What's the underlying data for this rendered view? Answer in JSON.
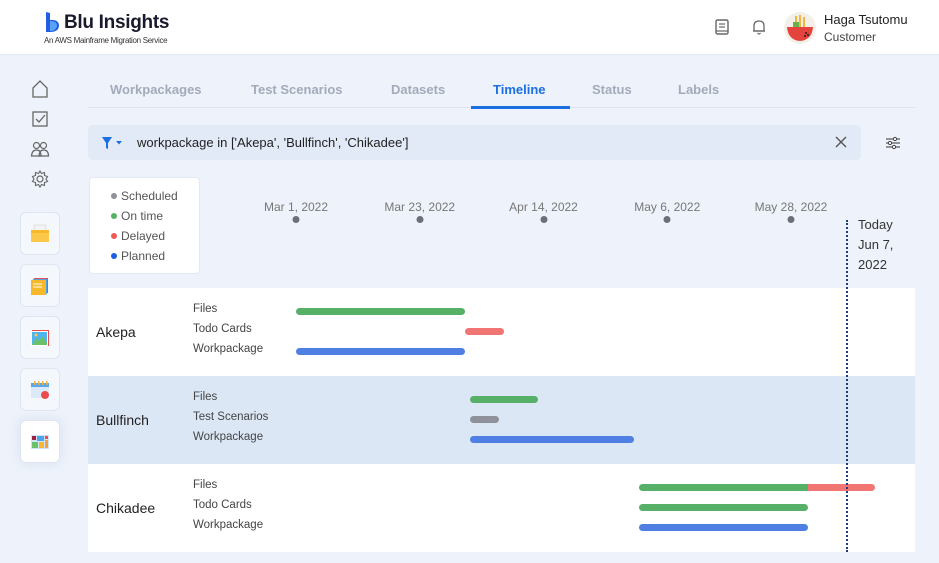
{
  "header": {
    "app_title": "Blu Insights",
    "app_subtitle": "An AWS Mainframe Migration Service",
    "user": {
      "name": "Haga Tsutomu",
      "role": "Customer"
    },
    "icons": [
      "documentation-icon",
      "bell-icon"
    ]
  },
  "sidebar": {
    "nav_icons": [
      "home-icon",
      "checkbox-icon",
      "users-icon",
      "gear-icon"
    ],
    "apps": [
      {
        "name": "folder-app"
      },
      {
        "name": "notes-app"
      },
      {
        "name": "image-app"
      },
      {
        "name": "calendar-app"
      },
      {
        "name": "dashboard-app",
        "active": true
      }
    ]
  },
  "tabs": [
    {
      "label": "Workpackages"
    },
    {
      "label": "Test Scenarios"
    },
    {
      "label": "Datasets"
    },
    {
      "label": "Timeline",
      "active": true
    },
    {
      "label": "Status"
    },
    {
      "label": "Labels"
    }
  ],
  "filter": {
    "query": "workpackage in ['Akepa', 'Bullfinch', 'Chikadee']"
  },
  "colors": {
    "scheduled": "#8e9199",
    "on_time": "#57b067",
    "delayed": "#f07573",
    "planned": "#4f7fe3",
    "accent": "#1b6fe0"
  },
  "legend": [
    {
      "label": "Scheduled",
      "key": "scheduled"
    },
    {
      "label": "On time",
      "key": "on_time"
    },
    {
      "label": "Delayed",
      "key": "delayed"
    },
    {
      "label": "Planned",
      "key": "planned"
    }
  ],
  "chart_data": {
    "type": "gantt",
    "start_date": "Mar 1, 2022",
    "x_ticks": [
      {
        "label": "Mar 1, 2022",
        "day": 0
      },
      {
        "label": "Mar 23, 2022",
        "day": 22
      },
      {
        "label": "Apr 14, 2022",
        "day": 44
      },
      {
        "label": "May 6, 2022",
        "day": 66
      },
      {
        "label": "May 28, 2022",
        "day": 88
      }
    ],
    "today": {
      "label_1": "Today",
      "label_2": "Jun 7,",
      "label_3": "2022",
      "day": 98
    },
    "x_range_days": [
      0,
      103
    ],
    "groups": [
      {
        "name": "Akepa",
        "rows": [
          {
            "label": "Files",
            "segments": [
              {
                "start": 0,
                "end": 30,
                "status": "on_time"
              }
            ]
          },
          {
            "label": "Todo Cards",
            "segments": [
              {
                "start": 30,
                "end": 37,
                "status": "delayed"
              }
            ]
          },
          {
            "label": "Workpackage",
            "segments": [
              {
                "start": 0,
                "end": 30,
                "status": "planned"
              }
            ]
          }
        ]
      },
      {
        "name": "Bullfinch",
        "highlighted": true,
        "rows": [
          {
            "label": "Files",
            "segments": [
              {
                "start": 31,
                "end": 43,
                "status": "on_time"
              }
            ]
          },
          {
            "label": "Test Scenarios",
            "segments": [
              {
                "start": 31,
                "end": 36,
                "status": "scheduled"
              }
            ]
          },
          {
            "label": "Workpackage",
            "segments": [
              {
                "start": 31,
                "end": 60,
                "status": "planned"
              }
            ]
          }
        ]
      },
      {
        "name": "Chikadee",
        "rows": [
          {
            "label": "Files",
            "segments": [
              {
                "start": 61,
                "end": 91,
                "status": "on_time"
              },
              {
                "start": 91,
                "end": 103,
                "status": "delayed"
              }
            ]
          },
          {
            "label": "Todo Cards",
            "segments": [
              {
                "start": 61,
                "end": 91,
                "status": "on_time"
              }
            ]
          },
          {
            "label": "Workpackage",
            "segments": [
              {
                "start": 61,
                "end": 91,
                "status": "planned"
              }
            ]
          }
        ]
      }
    ]
  }
}
